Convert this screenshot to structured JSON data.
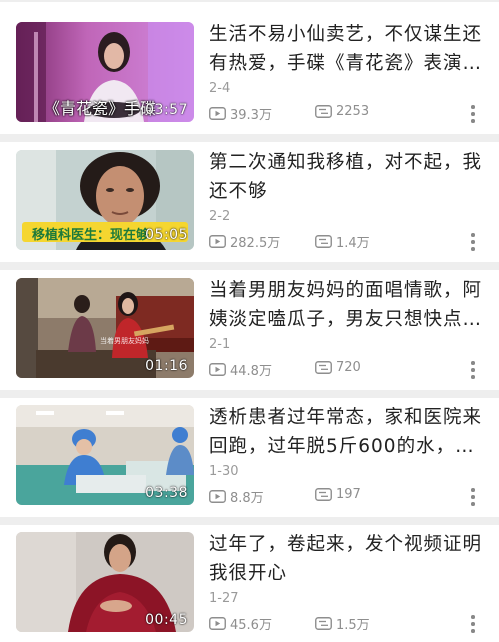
{
  "videos": [
    {
      "title": "生活不易小仙卖艺，不仅谋生还有热爱，手碟《青花瓷》表演…",
      "date": "2-4",
      "views": "39.3万",
      "comments": "2253",
      "duration": "03:57",
      "overlay_caption": "《青花瓷》手碟"
    },
    {
      "title": "第二次通知我移植，对不起，我还不够",
      "date": "2-2",
      "views": "282.5万",
      "comments": "1.4万",
      "duration": "05:05",
      "overlay_caption": "移植科医生：现在够"
    },
    {
      "title": "当着男朋友妈妈的面唱情歌，阿姨淡定嗑瓜子，男友只想快点…",
      "date": "2-1",
      "views": "44.8万",
      "comments": "720",
      "duration": "01:16",
      "overlay_caption": "当着男朋友妈妈"
    },
    {
      "title": "透析患者过年常态，家和医院来回跑，过年脱5斤600的水，…",
      "date": "1-30",
      "views": "8.8万",
      "comments": "197",
      "duration": "03:38"
    },
    {
      "title": "过年了，卷起来，发个视频证明我很开心",
      "date": "1-27",
      "views": "45.6万",
      "comments": "1.5万",
      "duration": "00:45"
    }
  ],
  "icons": {
    "views": "play-count-icon",
    "comments": "danmaku-icon",
    "more": "more-vertical-icon"
  },
  "colors": {
    "text": "#222222",
    "meta": "#8e8e8e",
    "divider": "#eeeeee"
  }
}
